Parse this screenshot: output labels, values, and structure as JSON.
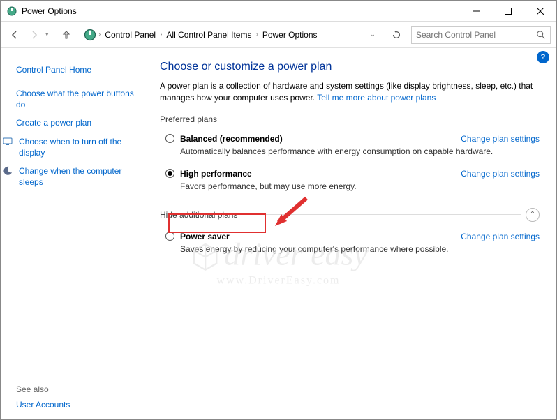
{
  "window": {
    "title": "Power Options"
  },
  "breadcrumb": {
    "items": [
      "Control Panel",
      "All Control Panel Items",
      "Power Options"
    ]
  },
  "search": {
    "placeholder": "Search Control Panel"
  },
  "sidebar": {
    "home": "Control Panel Home",
    "links": [
      "Choose what the power buttons do",
      "Create a power plan",
      "Choose when to turn off the display",
      "Change when the computer sleeps"
    ],
    "see_also_label": "See also",
    "see_also_links": [
      "User Accounts"
    ]
  },
  "main": {
    "title": "Choose or customize a power plan",
    "description": "A power plan is a collection of hardware and system settings (like display brightness, sleep, etc.) that manages how your computer uses power. ",
    "learn_more": "Tell me more about power plans",
    "preferred_label": "Preferred plans",
    "hide_label": "Hide additional plans",
    "change_link": "Change plan settings",
    "plans": [
      {
        "name": "Balanced (recommended)",
        "desc": "Automatically balances performance with energy consumption on capable hardware.",
        "selected": false
      },
      {
        "name": "High performance",
        "desc": "Favors performance, but may use more energy.",
        "selected": true
      }
    ],
    "additional_plans": [
      {
        "name": "Power saver",
        "desc": "Saves energy by reducing your computer's performance where possible.",
        "selected": false
      }
    ]
  },
  "watermark": {
    "main": "driver easy",
    "sub": "www.DriverEasy.com"
  }
}
